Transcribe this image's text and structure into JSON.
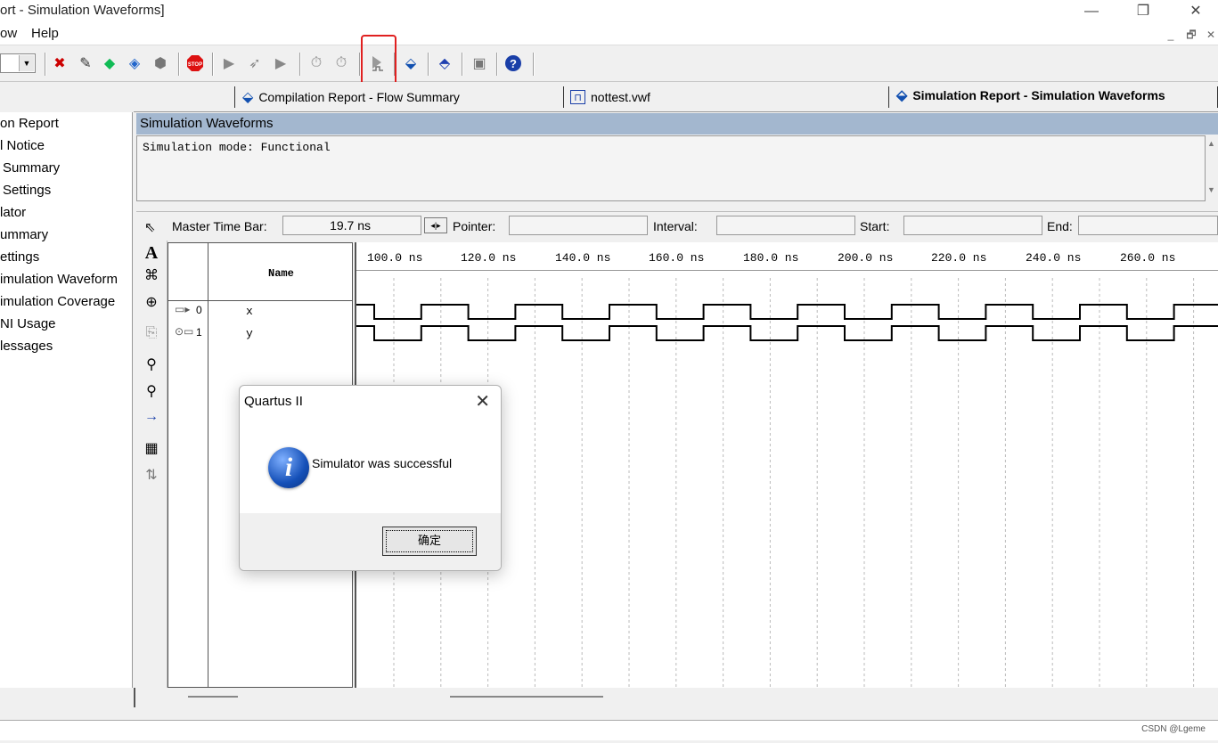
{
  "window": {
    "title": "ort - Simulation Waveforms]"
  },
  "menu": {
    "items": [
      "ow",
      "Help"
    ]
  },
  "toolbar": {
    "icons": [
      "cancel-compile-icon",
      "pencil-icon",
      "compile-icon",
      "analysis-icon",
      "fitter-icon",
      "stop-icon",
      "start-icon",
      "step-icon",
      "run-icon",
      "timing-icon",
      "clock-icon",
      "simulator-icon",
      "report-icon",
      "waveform-icon",
      "programmer-icon",
      "help-icon"
    ]
  },
  "tabs": [
    {
      "label": "Compilation Report - Flow Summary",
      "active": false
    },
    {
      "label": "nottest.vwf",
      "active": false
    },
    {
      "label": "Simulation Report - Simulation Waveforms",
      "active": true
    }
  ],
  "tree": {
    "items": [
      "on Report",
      "l Notice",
      "Summary",
      "Settings",
      "lator",
      "ummary",
      "ettings",
      "imulation Waveform",
      "imulation Coverage",
      "NI Usage",
      "lessages"
    ]
  },
  "sim": {
    "header": "Simulation Waveforms",
    "message": "Simulation mode: Functional"
  },
  "timebar": {
    "master_label": "Master Time Bar:",
    "master_value": "19.7 ns",
    "pointer_label": "Pointer:",
    "interval_label": "Interval:",
    "start_label": "Start:",
    "end_label": "End:"
  },
  "signals": {
    "name_header": "Name",
    "rows": [
      {
        "index": "0",
        "name": "x",
        "dir": "input"
      },
      {
        "index": "1",
        "name": "y",
        "dir": "output"
      }
    ]
  },
  "timeline": {
    "ticks": [
      "100.0 ns",
      "120.0 ns",
      "140.0 ns",
      "160.0 ns",
      "180.0 ns",
      "200.0 ns",
      "220.0 ns",
      "240.0 ns",
      "260.0 ns"
    ]
  },
  "dialog": {
    "title": "Quartus II",
    "message": "Simulator was successful",
    "ok_label": "确定"
  },
  "status": {
    "watermark": "CSDN @Lgeme"
  },
  "colors": {
    "header_bg": "#a3b7cf",
    "highlight": "#e02020"
  }
}
